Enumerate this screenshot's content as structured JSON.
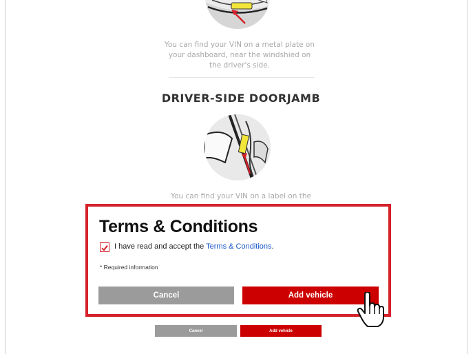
{
  "dashboard": {
    "help_text": "You can find your VIN on a metal plate on your dashboard, near the windshied on the driver's side."
  },
  "doorjamb": {
    "heading": "DRIVER-SIDE DOORJAMB",
    "help_text": "You can find your VIN on a label on the"
  },
  "modal": {
    "title": "Terms & Conditions",
    "accept_prefix": "I have read and accept the ",
    "accept_link": "Terms & Conditions",
    "accept_suffix": ".",
    "required_note": "* Required information",
    "cancel_label": "Cancel",
    "add_label": "Add vehicle",
    "checkbox_checked": true
  },
  "page_buttons": {
    "cancel_label": "Cancel",
    "add_label": "Add vehicle"
  },
  "colors": {
    "accent": "#d4212a",
    "button_red": "#cc0000",
    "button_gray": "#9b9b9b",
    "link": "#1a57c9",
    "highlight": "#f2e63a"
  },
  "icons": {
    "cursor": "hand-pointer-icon",
    "check": "checkmark-icon"
  }
}
